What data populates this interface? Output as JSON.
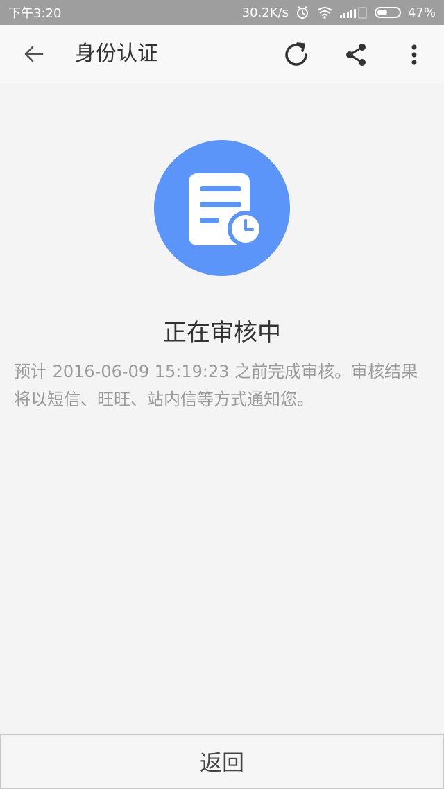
{
  "status_bar": {
    "time": "下午3:20",
    "network_speed": "30.2K/s",
    "battery_percent": "47%",
    "battery_level": 0.47,
    "icons": [
      "alarm-icon",
      "wifi-icon",
      "signal-icon",
      "battery-icon"
    ]
  },
  "app_bar": {
    "title": "身份认证",
    "icons": [
      "back-arrow-icon",
      "refresh-icon",
      "share-icon",
      "more-vert-icon"
    ]
  },
  "main": {
    "status_icon": "document-clock-icon",
    "accent_color": "#5b95f9",
    "heading": "正在审核中",
    "message": "预计 2016-06-09 15:19:23 之前完成审核。审核结果将以短信、旺旺、站内信等方式通知您。"
  },
  "bottom": {
    "back_label": "返回"
  }
}
